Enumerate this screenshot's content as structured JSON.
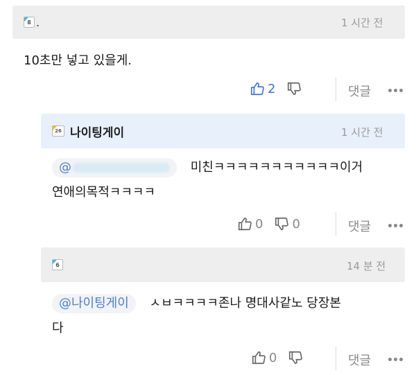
{
  "comments": [
    {
      "level_badge": "8",
      "nickname": ".",
      "time": "1 시간 전",
      "text": "10초만 넣고 있을게.",
      "likes": "2",
      "dislikes": "",
      "reply_label": "댓글"
    },
    {
      "level_badge": "26",
      "nickname": "나이팅게이",
      "time": "1 시간 전",
      "mention": "@",
      "text_line1": "미친ㅋㅋㅋㅋㅋㅋㅋㅋㅋㅋㅋ이거",
      "text_line2": "연애의목적ㅋㅋㅋㅋ",
      "likes": "0",
      "dislikes": "0",
      "reply_label": "댓글"
    },
    {
      "level_badge": "6",
      "nickname": "",
      "time": "14 분 전",
      "mention": "@나이팅게이",
      "text_line1": "ㅅㅂㅋㅋㅋㅋ존나 명대사같노 당장본",
      "text_line2": "다",
      "likes": "0",
      "dislikes": "",
      "reply_label": "댓글"
    }
  ],
  "colors": {
    "accent": "#3b74d9",
    "header_bg": "#eeeeee",
    "time": "#9a9a9a"
  }
}
